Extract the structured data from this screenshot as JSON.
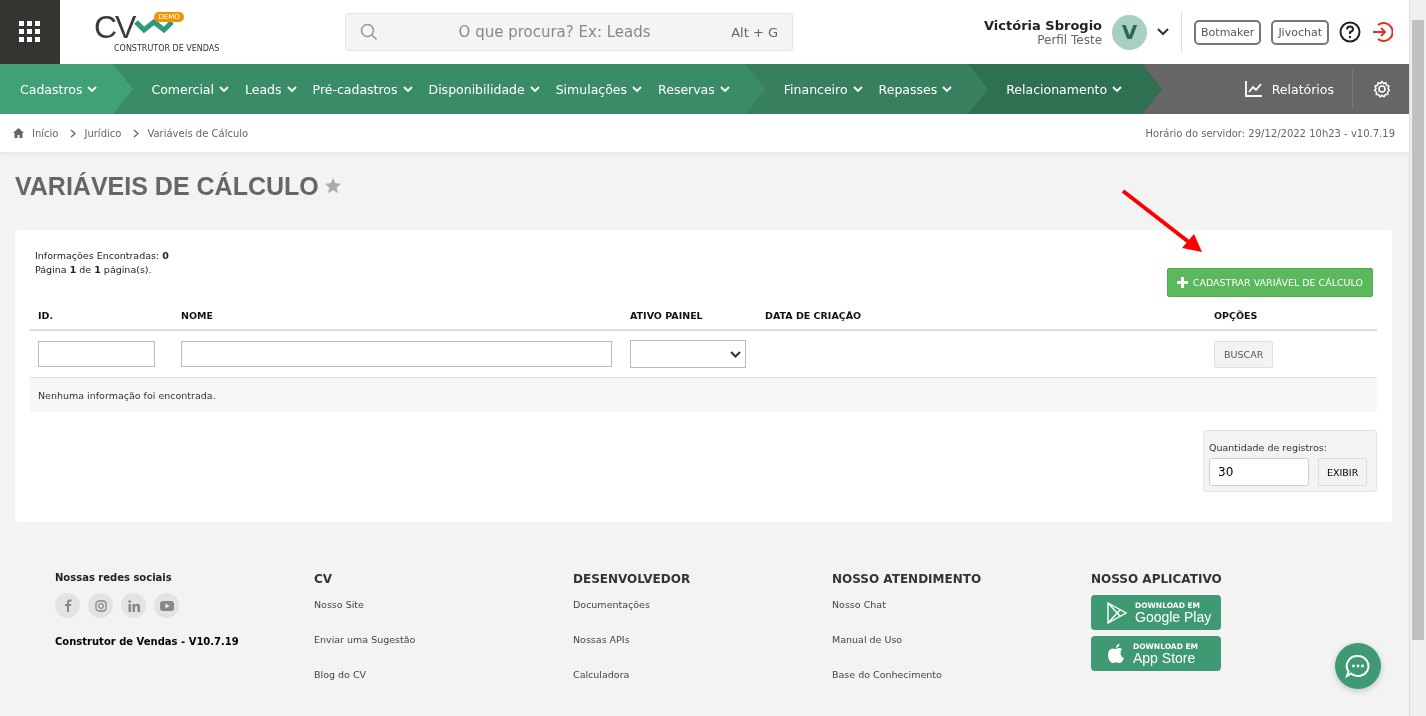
{
  "header": {
    "logo": {
      "letters": "CV",
      "badge": "DEMO",
      "tagline": "CONSTRUTOR DE VENDAS"
    },
    "search": {
      "placeholder": "O que procura? Ex: Leads",
      "shortcut": "Alt + G"
    },
    "user": {
      "name": "Victória Sbrogio",
      "profile": "Perfil Teste",
      "initial": "V"
    },
    "buttons": [
      "Botmaker",
      "Jivochat"
    ]
  },
  "nav": {
    "groups": [
      {
        "items": [
          "Cadastros"
        ]
      },
      {
        "items": [
          "Comercial",
          "Leads",
          "Pré-cadastros",
          "Disponibilidade",
          "Simulações",
          "Reservas"
        ]
      },
      {
        "items": [
          "Financeiro",
          "Repasses"
        ]
      },
      {
        "items": [
          "Relacionamento"
        ]
      }
    ],
    "reports": "Relatórios"
  },
  "breadcrumb": [
    "Início",
    "Jurídico",
    "Variáveis de Cálculo"
  ],
  "server_time": "Horário do servidor: 29/12/2022 10h23 - v10.7.19",
  "page": {
    "title": "VARIÁVEIS DE CÁLCULO",
    "favorite": false
  },
  "results": {
    "found_label": "Informações Encontradas:",
    "found": "0",
    "pages": "Página **1** de **1** página(s)."
  },
  "add_button": "CADASTRAR VARIÁVEL DE CÁLCULO",
  "table": {
    "columns": [
      {
        "label": "ID.",
        "kind": "text"
      },
      {
        "label": "NOME",
        "kind": "text"
      },
      {
        "label": "ATIVO PAINEL",
        "kind": "select"
      },
      {
        "label": "DATA DE CRIAÇÃO",
        "kind": "none"
      },
      {
        "label": "OPÇÕES",
        "kind": "button"
      }
    ],
    "search_button": "BUSCAR",
    "empty": "Nenhuma informação foi encontrada."
  },
  "page_size": {
    "label": "Quantidade de registros:",
    "value": "30",
    "button": "EXIBIR"
  },
  "footer": {
    "social_title": "Nossas redes sociais",
    "version": "Construtor de Vendas - V10.7.19",
    "columns": [
      {
        "title": "CV",
        "links": [
          "Nosso Site",
          "Enviar uma Sugestão",
          "Blog do CV"
        ]
      },
      {
        "title": "DESENVOLVEDOR",
        "links": [
          "Documentações",
          "Nossas APIs",
          "Calculadora"
        ]
      },
      {
        "title": "NOSSO ATENDIMENTO",
        "links": [
          "Nosso Chat",
          "Manual de Uso",
          "Base do Conhecimento"
        ]
      }
    ],
    "app_title": "NOSSO APLICATIVO",
    "stores": [
      {
        "kind": "google",
        "small": "DOWNLOAD EM",
        "big": "Google Play"
      },
      {
        "kind": "apple",
        "small": "DOWNLOAD EM",
        "big": "App Store"
      }
    ]
  }
}
